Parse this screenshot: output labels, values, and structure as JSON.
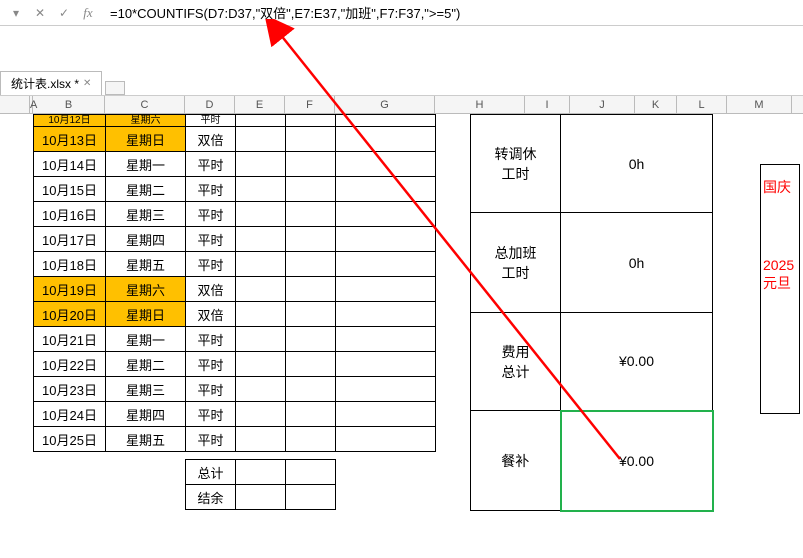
{
  "formula_bar": {
    "formula": "=10*COUNTIFS(D7:D37,\"双倍\",E7:E37,\"加班\",F7:F37,\">=5\")"
  },
  "tab": {
    "name": "统计表.xlsx *"
  },
  "columns": [
    "A",
    "B",
    "C",
    "D",
    "E",
    "F",
    "G",
    "H",
    "I",
    "J",
    "K",
    "L",
    "M"
  ],
  "left_rows": [
    {
      "date": "10月12日",
      "weekday": "星期六",
      "type": "平时",
      "hl": false,
      "half": true
    },
    {
      "date": "10月13日",
      "weekday": "星期日",
      "type": "双倍",
      "hl": true
    },
    {
      "date": "10月14日",
      "weekday": "星期一",
      "type": "平时",
      "hl": false
    },
    {
      "date": "10月15日",
      "weekday": "星期二",
      "type": "平时",
      "hl": false
    },
    {
      "date": "10月16日",
      "weekday": "星期三",
      "type": "平时",
      "hl": false
    },
    {
      "date": "10月17日",
      "weekday": "星期四",
      "type": "平时",
      "hl": false
    },
    {
      "date": "10月18日",
      "weekday": "星期五",
      "type": "平时",
      "hl": false
    },
    {
      "date": "10月19日",
      "weekday": "星期六",
      "type": "双倍",
      "hl": true
    },
    {
      "date": "10月20日",
      "weekday": "星期日",
      "type": "双倍",
      "hl": true
    },
    {
      "date": "10月21日",
      "weekday": "星期一",
      "type": "平时",
      "hl": false
    },
    {
      "date": "10月22日",
      "weekday": "星期二",
      "type": "平时",
      "hl": false
    },
    {
      "date": "10月23日",
      "weekday": "星期三",
      "type": "平时",
      "hl": false
    },
    {
      "date": "10月24日",
      "weekday": "星期四",
      "type": "平时",
      "hl": false
    },
    {
      "date": "10月25日",
      "weekday": "星期五",
      "type": "平时",
      "hl": false
    }
  ],
  "bottom_labels": {
    "total": "总计",
    "balance": "结余"
  },
  "summary": [
    {
      "label": "转调休\n工时",
      "value": "0h"
    },
    {
      "label": "总加班\n工时",
      "value": "0h"
    },
    {
      "label": "费用\n总计",
      "value": "¥0.00"
    },
    {
      "label": "餐补",
      "value": "¥0.00"
    }
  ],
  "side": {
    "line1": "国庆",
    "line2": "2025",
    "line3": "元旦"
  }
}
